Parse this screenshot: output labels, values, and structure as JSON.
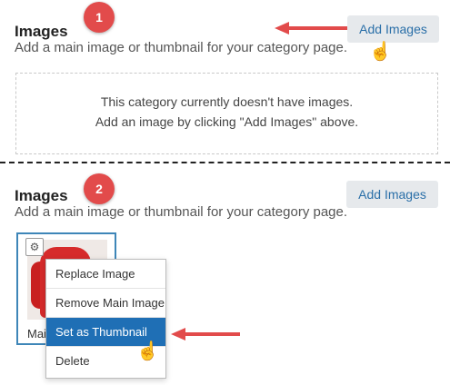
{
  "panel1": {
    "badge": "1",
    "heading": "Images",
    "subtitle": "Add a main image or thumbnail for your category page.",
    "add_button": "Add Images",
    "empty_line1": "This category currently doesn't have images.",
    "empty_line2": "Add an image by clicking \"Add Images\" above."
  },
  "panel2": {
    "badge": "2",
    "heading": "Images",
    "subtitle": "Add a main image or thumbnail for your category page.",
    "add_button": "Add Images",
    "card_label": "Mai",
    "menu": [
      "Replace Image",
      "Remove Main Image",
      "Set as Thumbnail",
      "Delete"
    ]
  },
  "colors": {
    "badge": "#e24b4b",
    "arrow": "#e24b4b",
    "menu_active": "#1f6fb5",
    "card_border": "#3e86b8",
    "button_text": "#2a6fa8"
  },
  "icons": [
    "gear-icon",
    "hand-cursor-icon",
    "arrow-left-icon"
  ]
}
